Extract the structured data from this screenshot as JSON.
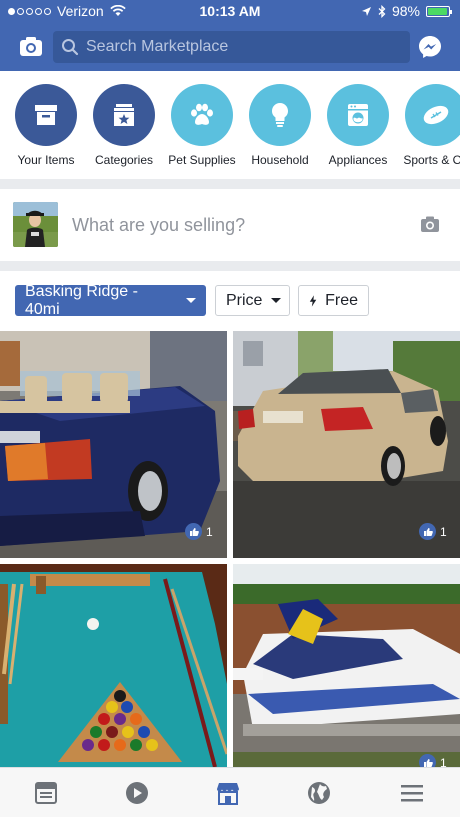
{
  "status": {
    "carrier": "Verizon",
    "time": "10:13 AM",
    "battery": "98%"
  },
  "search": {
    "placeholder": "Search Marketplace"
  },
  "categories": [
    {
      "label": "Your Items",
      "icon": "box-icon",
      "style": "dark"
    },
    {
      "label": "Categories",
      "icon": "star-box-icon",
      "style": "dark"
    },
    {
      "label": "Pet Supplies",
      "icon": "paw-icon",
      "style": "light"
    },
    {
      "label": "Household",
      "icon": "lightbulb-icon",
      "style": "light"
    },
    {
      "label": "Appliances",
      "icon": "washer-icon",
      "style": "light"
    },
    {
      "label": "Sports & Ou",
      "icon": "football-icon",
      "style": "light"
    }
  ],
  "sell": {
    "prompt": "What are you selling?"
  },
  "filters": {
    "location": "Basking Ridge - 40mi",
    "price": "Price",
    "free": "Free"
  },
  "listings": [
    {
      "name": "blue convertible car",
      "likes": "1"
    },
    {
      "name": "gold sedan car",
      "likes": "1"
    },
    {
      "name": "pool table",
      "likes": ""
    },
    {
      "name": "jet ski",
      "likes": "1"
    }
  ],
  "colors": {
    "brand": "#4267b2",
    "dark_circle": "#3b5998",
    "light_circle": "#5bc0de"
  }
}
